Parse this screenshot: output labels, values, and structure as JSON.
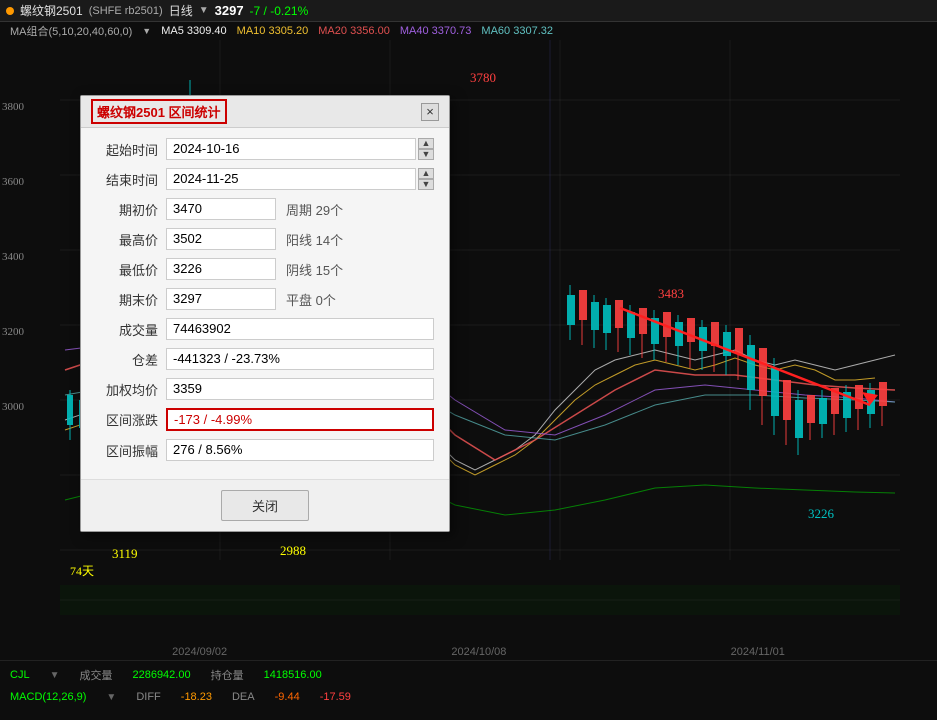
{
  "toolbar": {
    "symbol": "螺纹钢2501",
    "exchange": "SHFE rb2501",
    "period": "日线",
    "price": "3297",
    "change": "-7 / -0.21%"
  },
  "ma": {
    "label": "MA组合(5,10,20,40,60,0)",
    "ma5_label": "MA5",
    "ma5_val": "3309.40",
    "ma10_label": "MA10",
    "ma10_val": "3305.20",
    "ma20_label": "MA20",
    "ma20_val": "3356.00",
    "ma40_label": "MA40",
    "ma40_val": "3370.73",
    "ma60_label": "MA60",
    "ma60_val": "3307.32"
  },
  "chart_labels": {
    "price_3780": "3780",
    "price_3483": "3483",
    "price_3226": "3226",
    "price_3119": "3119",
    "price_2988": "2988"
  },
  "price_axis": {
    "p3800": "3800",
    "p3600": "3600",
    "p3400": "3400",
    "p3200": "3200",
    "p3000": "3000"
  },
  "date_axis": {
    "d1": "2024/09/02",
    "d2": "2024/10/08",
    "d3": "2024/11/01"
  },
  "bottom": {
    "days_label": "74天",
    "vol_label": "成交量",
    "vol_val": "2286942.00",
    "pos_label": "持仓量",
    "pos_val": "1418516.00",
    "cjl_label": "CJL",
    "macd_label": "MACD(12,26,9)",
    "diff_label": "DIFF",
    "diff_val": "-18.23",
    "dea_label": "DEA",
    "dea_val": "-9.44",
    "macd_val": "-17.59"
  },
  "dialog": {
    "title": "螺纹钢2501 区间统计",
    "close_label": "×",
    "start_label": "起始时间",
    "start_val": "2024-10-16",
    "end_label": "结束时间",
    "end_val": "2024-11-25",
    "open_label": "期初价",
    "open_val": "3470",
    "high_label": "最高价",
    "high_val": "3502",
    "low_label": "最低价",
    "low_val": "3226",
    "close_label_val": "期末价",
    "close_val": "3297",
    "vol_label": "成交量",
    "vol_val": "74463902",
    "oi_label": "仓差",
    "oi_val": "-441323 / -23.73%",
    "avg_label": "加权均价",
    "avg_val": "3359",
    "change_label": "区间涨跌",
    "change_val": "-173 / -4.99%",
    "range_label": "区间振幅",
    "range_val": "276 / 8.56%",
    "period_label": "周期",
    "period_val": "29个",
    "yang_label": "阳线",
    "yang_val": "14个",
    "yin_label": "阴线",
    "yin_val": "15个",
    "flat_label": "平盘",
    "flat_val": "0个",
    "close_button": "关闭"
  }
}
